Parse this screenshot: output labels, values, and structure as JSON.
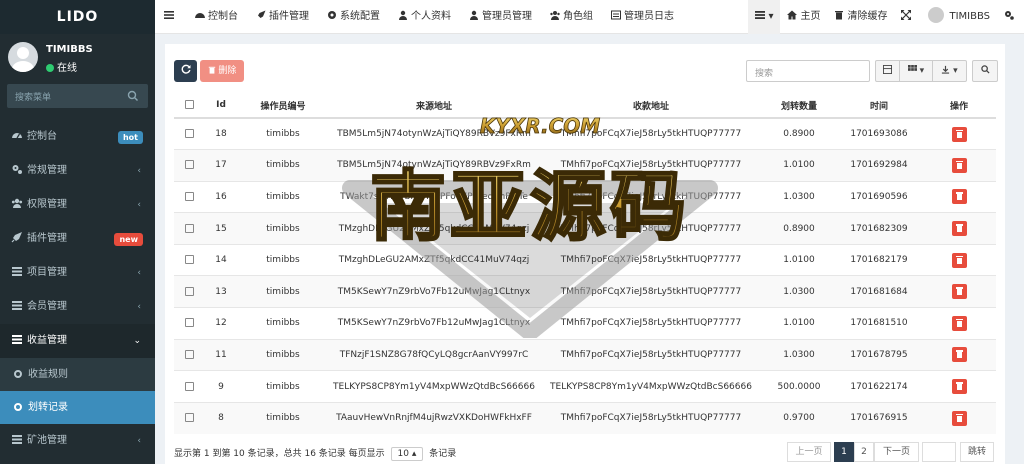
{
  "app": {
    "logo": "LIDO"
  },
  "user": {
    "name": "TIMIBBS",
    "status": "在线"
  },
  "sidebar": {
    "search_placeholder": "搜索菜单",
    "items": [
      {
        "label": "控制台",
        "badge": "hot"
      },
      {
        "label": "常规管理"
      },
      {
        "label": "权限管理"
      },
      {
        "label": "插件管理",
        "badge": "new"
      },
      {
        "label": "项目管理"
      },
      {
        "label": "会员管理"
      },
      {
        "label": "收益管理"
      },
      {
        "label": "收益规则"
      },
      {
        "label": "划转记录"
      },
      {
        "label": "矿池管理"
      }
    ]
  },
  "topnav": {
    "items": [
      "控制台",
      "插件管理",
      "系统配置",
      "个人资料",
      "管理员管理",
      "角色组",
      "管理员日志"
    ],
    "home": "主页",
    "clear_cache": "清除缓存",
    "user": "TIMIBBS"
  },
  "toolbar": {
    "delete": "删除",
    "search_placeholder": "搜索"
  },
  "table": {
    "headers": [
      "Id",
      "操作员编号",
      "来源地址",
      "收款地址",
      "划转数量",
      "时间",
      "操作"
    ],
    "rows": [
      {
        "id": "18",
        "op": "timibbs",
        "from": "TBM5Lm5jN74otynWzAjTiQY89RBVz9FxRm",
        "to": "TMhfi7poFCqX7ieJ58rLy5tkHTUQP77777",
        "amount": "0.8900",
        "time": "1701693086"
      },
      {
        "id": "17",
        "op": "timibbs",
        "from": "TBM5Lm5jN74otynWzAjTiQY89RBVz9FxRm",
        "to": "TMhfi7poFCqX7ieJ58rLy5tkHTUQP77777",
        "amount": "1.0100",
        "time": "1701692984"
      },
      {
        "id": "16",
        "op": "timibbs",
        "from": "TWakt7swHUybPeMBYPFo67PuTedAhPTiTe",
        "to": "TMhfi7poFCqX7ieJ58rLy5tkHTUQP77777",
        "amount": "1.0300",
        "time": "1701690596"
      },
      {
        "id": "15",
        "op": "timibbs",
        "from": "TMzghDLeGU2AMxZTf5qkdCC41MuV74qzj",
        "to": "TMhfi7poFCqX7ieJ58rLy5tkHTUQP77777",
        "amount": "0.8900",
        "time": "1701682309"
      },
      {
        "id": "14",
        "op": "timibbs",
        "from": "TMzghDLeGU2AMxZTf5qkdCC41MuV74qzj",
        "to": "TMhfi7poFCqX7ieJ58rLy5tkHTUQP77777",
        "amount": "1.0100",
        "time": "1701682179"
      },
      {
        "id": "13",
        "op": "timibbs",
        "from": "TM5KSewY7nZ9rbVo7Fb12uMwJag1CLtnyx",
        "to": "TMhfi7poFCqX7ieJ58rLy5tkHTUQP77777",
        "amount": "1.0300",
        "time": "1701681684"
      },
      {
        "id": "12",
        "op": "timibbs",
        "from": "TM5KSewY7nZ9rbVo7Fb12uMwJag1CLtnyx",
        "to": "TMhfi7poFCqX7ieJ58rLy5tkHTUQP77777",
        "amount": "1.0100",
        "time": "1701681510"
      },
      {
        "id": "11",
        "op": "timibbs",
        "from": "TFNzjF1SNZ8G78fQCyLQ8gcrAanVY997rC",
        "to": "TMhfi7poFCqX7ieJ58rLy5tkHTUQP77777",
        "amount": "1.0300",
        "time": "1701678795"
      },
      {
        "id": "9",
        "op": "timibbs",
        "from": "TELKYPS8CP8Ym1yV4MxpWWzQtdBcS66666",
        "to": "TELKYPS8CP8Ym1yV4MxpWWzQtdBcS66666",
        "amount": "500.0000",
        "time": "1701622174"
      },
      {
        "id": "8",
        "op": "timibbs",
        "from": "TAauvHewVnRnjfM4ujRwzVXKDoHWFkHxFF",
        "to": "TMhfi7poFCqX7ieJ58rLy5tkHTUQP77777",
        "amount": "0.9700",
        "time": "1701676915"
      }
    ]
  },
  "pagination": {
    "info_prefix": "显示第 1 到第 10 条记录，总共 16 条记录 每页显示",
    "page_size": "10",
    "info_suffix": "条记录",
    "prev": "上一页",
    "pages": [
      "1",
      "2"
    ],
    "next": "下一页",
    "jump": "跳转"
  },
  "watermark": {
    "top": "KYXR.COM",
    "main": "南亚源码"
  },
  "colors": {
    "sidebar": "#222d32",
    "active": "#3c8dbc",
    "danger": "#e74c3c",
    "primary": "#2c3e50"
  }
}
